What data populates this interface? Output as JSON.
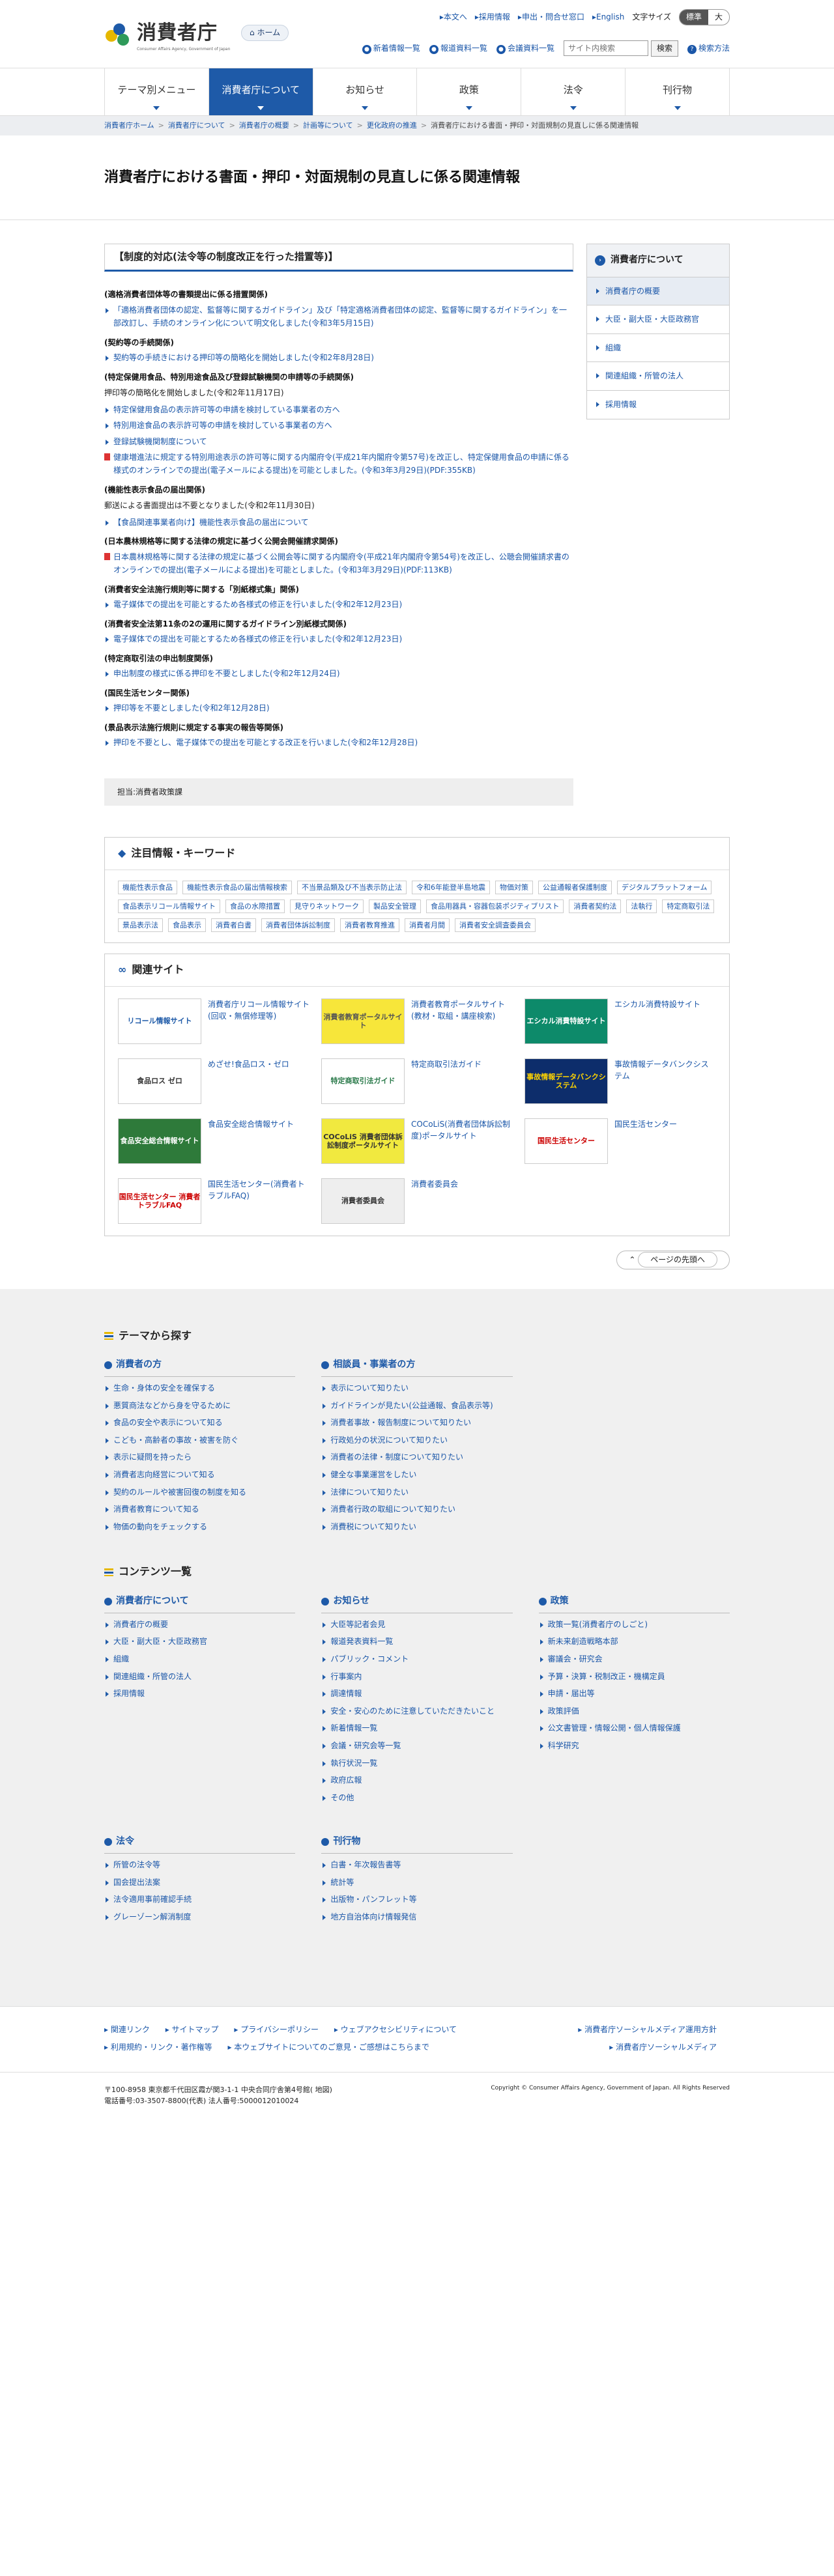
{
  "header": {
    "logo_text": "消費者庁",
    "logo_sub": "Consumer Affairs Agency, Government of Japan",
    "home": "ホーム",
    "util_links": [
      "本文へ",
      "採用情報",
      "申出・問合せ窓口",
      "English"
    ],
    "font_size_label": "文字サイズ",
    "font_standard": "標準",
    "font_large": "大",
    "sub_links": [
      "新着情報一覧",
      "報道資料一覧",
      "会議資料一覧"
    ],
    "search_placeholder": "サイト内検索",
    "search_btn": "検索",
    "search_help": "検索方法"
  },
  "gnav": [
    "テーマ別メニュー",
    "消費者庁について",
    "お知らせ",
    "政策",
    "法令",
    "刊行物"
  ],
  "breadcrumb": [
    "消費者庁ホーム",
    "消費者庁について",
    "消費者庁の概要",
    "計画等について",
    "更化政府の推進",
    "消費者庁における書面・押印・対面規制の見直しに係る関連情報"
  ],
  "page_title": "消費者庁における書面・押印・対面規制の見直しに係る関連情報",
  "main": {
    "section_title": "【制度的対応(法令等の制度改正を行った措置等)】",
    "sections": [
      {
        "h": "(適格消費者団体等の書類提出に係る措置関係)",
        "items": [
          "「適格消費者団体の認定、監督等に関するガイドライン」及び「特定適格消費者団体の認定、監督等に関するガイドライン」を一部改訂し、手続のオンライン化について明文化しました(令和3年5月15日)"
        ]
      },
      {
        "h": "(契約等の手続関係)",
        "items": [
          "契約等の手続きにおける押印等の簡略化を開始しました(令和2年8月28日)"
        ]
      },
      {
        "h": "(特定保健用食品、特別用途食品及び登録試験機関の申請等の手続関係)",
        "p": "押印等の簡略化を開始しました(令和2年11月17日)",
        "items": [
          "特定保健用食品の表示許可等の申請を検討している事業者の方へ",
          "特別用途食品の表示許可等の申請を検討している事業者の方へ",
          "登録試験機関制度について"
        ],
        "pdf": "健康増進法に規定する特別用途表示の許可等に関する内閣府令(平成21年内閣府令第57号)を改正し、特定保健用食品の申請に係る様式のオンラインでの提出(電子メールによる提出)を可能としました。(令和3年3月29日)(PDF:355KB)"
      },
      {
        "h": "(機能性表示食品の届出関係)",
        "p": "郵送による書面提出は不要となりました(令和2年11月30日)",
        "items": [
          "【食品関連事業者向け】機能性表示食品の届出について"
        ]
      },
      {
        "h": "(日本農林規格等に関する法律の規定に基づく公開会開催請求関係)",
        "pdf": "日本農林規格等に関する法律の規定に基づく公開会等に関する内閣府令(平成21年内閣府令第54号)を改正し、公聴会開催請求書のオンラインでの提出(電子メールによる提出)を可能としました。(令和3年3月29日)(PDF:113KB)",
        "items": []
      },
      {
        "h": "(消費者安全法施行規則等に関する「別紙様式集」関係)",
        "items": [
          "電子媒体での提出を可能とするため各様式の修正を行いました(令和2年12月23日)"
        ]
      },
      {
        "h": "(消費者安全法第11条の2の運用に関するガイドライン別紙様式関係)",
        "items": [
          "電子媒体での提出を可能とするため各様式の修正を行いました(令和2年12月23日)"
        ]
      },
      {
        "h": "(特定商取引法の申出制度関係)",
        "items": [
          "申出制度の様式に係る押印を不要としました(令和2年12月24日)"
        ]
      },
      {
        "h": "(国民生活センター関係)",
        "items": [
          "押印等を不要としました(令和2年12月28日)"
        ]
      },
      {
        "h": "(景品表示法施行規則に規定する事実の報告等関係)",
        "items": [
          "押印を不要とし、電子媒体での提出を可能とする改正を行いました(令和2年12月28日)"
        ]
      }
    ],
    "note": "担当:消費者政策課"
  },
  "side": {
    "title": "消費者庁について",
    "items": [
      "消費者庁の概要",
      "大臣・副大臣・大臣政務官",
      "組織",
      "関連組織・所管の法人",
      "採用情報"
    ]
  },
  "keywords": {
    "title": "注目情報・キーワード",
    "tags": [
      "機能性表示食品",
      "機能性表示食品の届出情報検索",
      "不当景品類及び不当表示防止法",
      "令和6年能登半島地震",
      "物価対策",
      "公益通報者保護制度",
      "デジタルプラットフォーム",
      "食品表示リコール情報サイト",
      "食品の水際措置",
      "見守りネットワーク",
      "製品安全管理",
      "食品用器具・容器包装ポジティブリスト",
      "消費者契約法",
      "法執行",
      "特定商取引法",
      "景品表示法",
      "食品表示",
      "消費者白書",
      "消費者団体訴訟制度",
      "消費者教育推進",
      "消費者月間",
      "消費者安全調査委員会"
    ]
  },
  "related": {
    "title": "関連サイト",
    "sites": [
      {
        "banner": "リコール情報サイト",
        "bg": "#ffffff",
        "fg": "#1e5aa8",
        "text": "消費者庁リコール情報サイト(回収・無償修理等)"
      },
      {
        "banner": "消費者教育ポータルサイト",
        "bg": "#f7e63a",
        "fg": "#555",
        "text": "消費者教育ポータルサイト(教材・取組・講座検索)"
      },
      {
        "banner": "エシカル消費特設サイト",
        "bg": "#0d8a6a",
        "fg": "#ffffff",
        "text": "エシカル消費特設サイト"
      },
      {
        "banner": "食品ロス ゼロ",
        "bg": "#ffffff",
        "fg": "#333",
        "text": "めざせ!食品ロス・ゼロ"
      },
      {
        "banner": "特定商取引法ガイド",
        "bg": "#ffffff",
        "fg": "#2a7a4a",
        "text": "特定商取引法ガイド"
      },
      {
        "banner": "事故情報データバンクシステム",
        "bg": "#0d2d6b",
        "fg": "#ffd400",
        "text": "事故情報データバンクシステム"
      },
      {
        "banner": "食品安全総合情報サイト",
        "bg": "#2e7a3a",
        "fg": "#ffffff",
        "text": "食品安全総合情報サイト"
      },
      {
        "banner": "COCoLiS 消費者団体訴訟制度ポータルサイト",
        "bg": "#f1e93f",
        "fg": "#333",
        "text": "COCoLiS(消費者団体訴訟制度)ポータルサイト"
      },
      {
        "banner": "国民生活センター",
        "bg": "#ffffff",
        "fg": "#c00",
        "text": "国民生活センター"
      },
      {
        "banner": "国民生活センター 消費者トラブルFAQ",
        "bg": "#ffffff",
        "fg": "#c00",
        "text": "国民生活センター(消費者トラブルFAQ)"
      },
      {
        "banner": "消費者委員会",
        "bg": "#eeeeee",
        "fg": "#333",
        "text": "消費者委員会"
      }
    ]
  },
  "totop": "ページの先頭へ",
  "theme": {
    "title": "テーマから探す",
    "cols": [
      {
        "h": "消費者の方",
        "items": [
          "生命・身体の安全を確保する",
          "悪質商法などから身を守るために",
          "食品の安全や表示について知る",
          "こども・高齢者の事故・被害を防ぐ",
          "表示に疑問を持ったら",
          "消費者志向経営について知る",
          "契約のルールや被害回復の制度を知る",
          "消費者教育について知る",
          "物価の動向をチェックする"
        ]
      },
      {
        "h": "相談員・事業者の方",
        "items": [
          "表示について知りたい",
          "ガイドラインが見たい(公益通報、食品表示等)",
          "消費者事故・報告制度について知りたい",
          "行政処分の状況について知りたい",
          "消費者の法律・制度について知りたい",
          "健全な事業運営をしたい",
          "法律について知りたい",
          "消費者行政の取組について知りたい",
          "消費税について知りたい"
        ]
      }
    ]
  },
  "contents": {
    "title": "コンテンツ一覧",
    "cols": [
      {
        "h": "消費者庁について",
        "items": [
          "消費者庁の概要",
          "大臣・副大臣・大臣政務官",
          "組織",
          "関連組織・所管の法人",
          "採用情報"
        ]
      },
      {
        "h": "お知らせ",
        "items": [
          "大臣等記者会見",
          "報道発表資料一覧",
          "パブリック・コメント",
          "行事案内",
          "調達情報",
          "安全・安心のために注意していただきたいこと",
          "新着情報一覧",
          "会議・研究会等一覧",
          "執行状況一覧",
          "政府広報",
          "その他"
        ]
      },
      {
        "h": "政策",
        "items": [
          "政策一覧(消費者庁のしごと)",
          "新未来創造戦略本部",
          "審議会・研究会",
          "予算・決算・税制改正・機構定員",
          "申請・届出等",
          "政策評価",
          "公文書管理・情報公開・個人情報保護",
          "科学研究"
        ]
      }
    ],
    "cols2": [
      {
        "h": "法令",
        "items": [
          "所管の法令等",
          "国会提出法案",
          "法令適用事前確認手続",
          "グレーゾーン解消制度"
        ]
      },
      {
        "h": "刊行物",
        "items": [
          "白書・年次報告書等",
          "統計等",
          "出版物・パンフレット等",
          "地方自治体向け情報発信"
        ]
      }
    ]
  },
  "footer": {
    "links1": [
      "関連リンク",
      "サイトマップ",
      "プライバシーポリシー",
      "ウェブアクセシビリティについて"
    ],
    "links2": [
      "利用規約・リンク・著作権等",
      "本ウェブサイトについてのご意見・ご感想はこちらまで"
    ],
    "right1": "消費者庁ソーシャルメディア運用方針",
    "right2": "消費者庁ソーシャルメディア",
    "address": "〒100-8958 東京都千代田区霞が関3-1-1 中央合同庁舎第4号館( 地図)",
    "tel": "電話番号:03-3507-8800(代表) 法人番号:5000012010024",
    "copyright": "Copyright © Consumer Affairs Agency, Government of Japan. All Rights Reserved"
  }
}
